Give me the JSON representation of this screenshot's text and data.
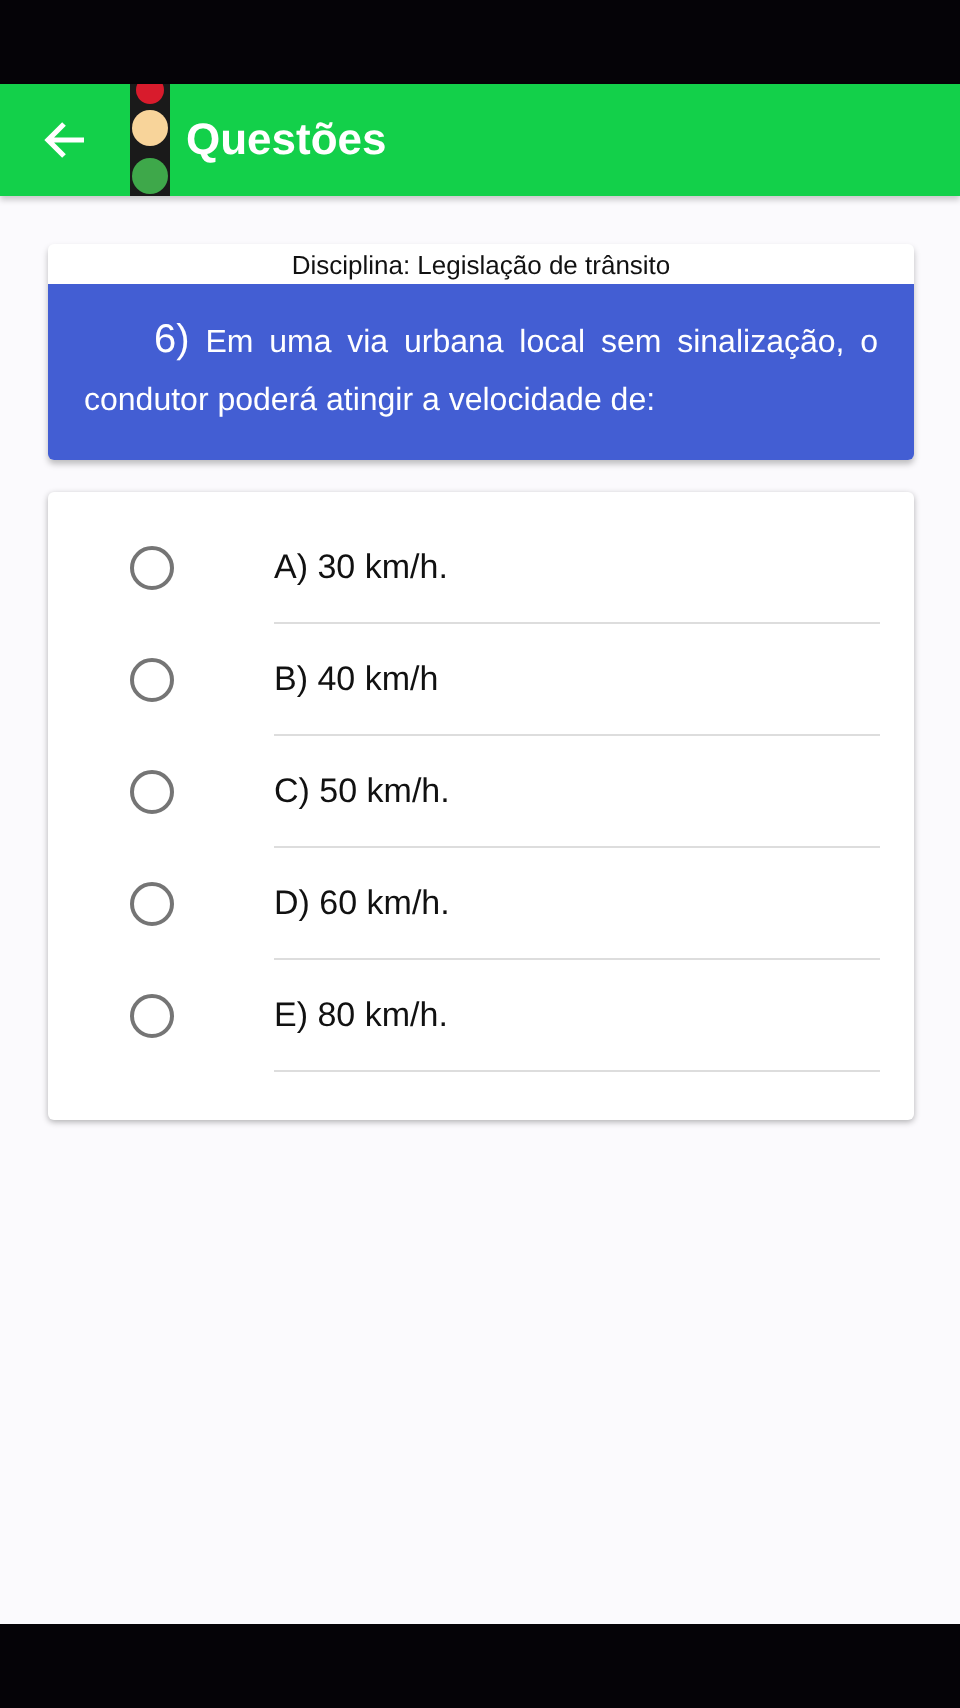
{
  "app_bar": {
    "title": "Questões"
  },
  "subject": "Disciplina: Legislação de trânsito",
  "question": {
    "number": "6)",
    "text": "Em uma via urbana local sem sinalização, o condutor poderá atingir a velocidade de:"
  },
  "options": [
    {
      "label": "A) 30 km/h.",
      "selected": false
    },
    {
      "label": "B) 40 km/h",
      "selected": false
    },
    {
      "label": "C) 50 km/h.",
      "selected": false
    },
    {
      "label": "D) 60 km/h.",
      "selected": false
    },
    {
      "label": "E) 80 km/h.",
      "selected": false
    }
  ]
}
